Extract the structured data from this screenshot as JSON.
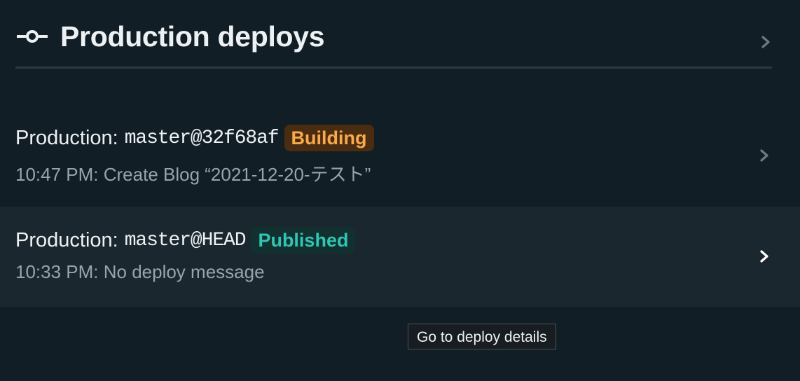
{
  "header": {
    "title": "Production deploys",
    "icon": "git-commit-icon",
    "chevron_icon": "chevron-right-icon"
  },
  "deploys": [
    {
      "prefix": "Production:",
      "ref": "master@32f68af",
      "status": "Building",
      "status_color": "#f8aa4c",
      "subtitle": "10:47 PM: Create Blog “2021-12-20-テスト”"
    },
    {
      "prefix": "Production:",
      "ref": "master@HEAD",
      "status": "Published",
      "status_color": "#31c5b3",
      "subtitle": "10:33 PM: No deploy message"
    }
  ],
  "tooltip": {
    "text": "Go to deploy details"
  },
  "colors": {
    "background": "#111e25",
    "hover_row": "#1b272e",
    "building": "#f8aa4c",
    "published": "#31c5b3"
  }
}
